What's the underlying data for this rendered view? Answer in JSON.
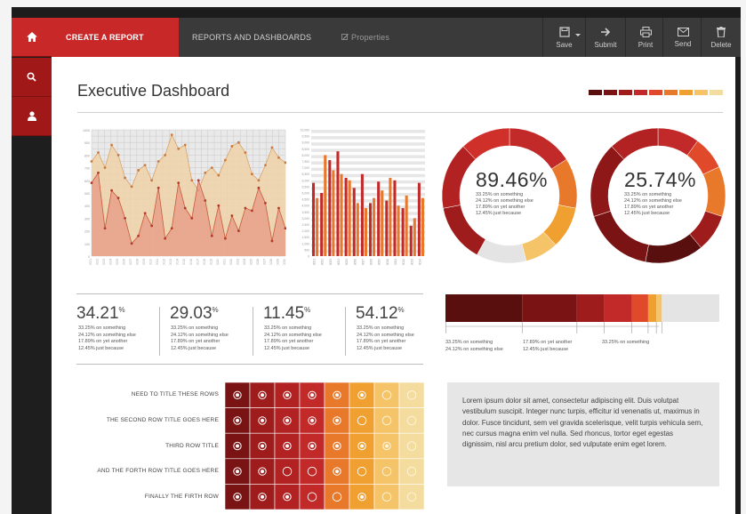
{
  "nav": {
    "create_label": "CREATE A REPORT",
    "reports_label": "REPORTS AND DASHBOARDS",
    "properties_label": "Properties",
    "tools": [
      {
        "label": "Save",
        "icon": "save-icon"
      },
      {
        "label": "Submit",
        "icon": "arrow-right-icon"
      },
      {
        "label": "Print",
        "icon": "printer-icon"
      },
      {
        "label": "Send",
        "icon": "envelope-icon"
      },
      {
        "label": "Delete",
        "icon": "trash-icon"
      }
    ],
    "sidebar": [
      "home-icon",
      "search-icon",
      "user-icon"
    ]
  },
  "page": {
    "title": "Executive Dashboard"
  },
  "palette": [
    "#5a0f0f",
    "#7a1414",
    "#9e1c1c",
    "#c22a2a",
    "#e0492a",
    "#e8782a",
    "#f0a030",
    "#f5c468",
    "#f3dc9e"
  ],
  "stats": [
    {
      "value": "34.21",
      "unit": "%",
      "lines": [
        "33.25% on something",
        "24.12% on something else",
        "17.89% on yet another",
        "12.45% just because"
      ]
    },
    {
      "value": "29.03",
      "unit": "%",
      "lines": [
        "33.25% on something",
        "24.12% on something else",
        "17.89% on yet another",
        "12.45% just because"
      ]
    },
    {
      "value": "11.45",
      "unit": "%",
      "lines": [
        "33.25% on something",
        "24.12% on something else",
        "17.89% on yet another",
        "12.45% just because"
      ]
    },
    {
      "value": "54.12",
      "unit": "%",
      "lines": [
        "33.25% on something",
        "24.12% on something else",
        "17.89% on yet another",
        "12.45% just because"
      ]
    }
  ],
  "donuts": [
    {
      "value": "89.46%",
      "lines": [
        "33.25% on something",
        "24.12% on something else",
        "17.89% on yet another",
        "12.45% just because"
      ],
      "segments": [
        {
          "v": 16,
          "c": "#c22a2a"
        },
        {
          "v": 12,
          "c": "#e8782a"
        },
        {
          "v": 10,
          "c": "#f0a030"
        },
        {
          "v": 8,
          "c": "#f5c468"
        },
        {
          "v": 12,
          "c": "#e4e4e4"
        },
        {
          "v": 14,
          "c": "#9e1c1c"
        },
        {
          "v": 16,
          "c": "#b22222"
        },
        {
          "v": 12,
          "c": "#d0302a"
        }
      ]
    },
    {
      "value": "25.74%",
      "lines": [
        "33.25% on something",
        "24.12% on something else",
        "17.89% on yet another",
        "12.45% just because"
      ],
      "segments": [
        {
          "v": 10,
          "c": "#c22a2a"
        },
        {
          "v": 8,
          "c": "#e0492a"
        },
        {
          "v": 12,
          "c": "#e8782a"
        },
        {
          "v": 9,
          "c": "#9e1c1c"
        },
        {
          "v": 14,
          "c": "#5a0f0f"
        },
        {
          "v": 17,
          "c": "#7a1414"
        },
        {
          "v": 18,
          "c": "#8e1818"
        },
        {
          "v": 12,
          "c": "#b22222"
        }
      ]
    }
  ],
  "stacked_bar": {
    "segments": [
      {
        "v": 28,
        "c": "#5a0f0f"
      },
      {
        "v": 20,
        "c": "#7a1414"
      },
      {
        "v": 10,
        "c": "#9e1c1c"
      },
      {
        "v": 10,
        "c": "#c22a2a"
      },
      {
        "v": 6,
        "c": "#e0492a"
      },
      {
        "v": 3,
        "c": "#f0a030"
      },
      {
        "v": 2,
        "c": "#f5c468"
      },
      {
        "v": 21,
        "c": "#e4e4e4"
      }
    ],
    "legend": [
      {
        "lines": [
          "33.25% on something",
          "24.12% on something else"
        ]
      },
      {
        "lines": [
          "17.89% on yet another",
          "12.45% just because"
        ]
      },
      {
        "lines": [
          "33.25% on something"
        ]
      }
    ]
  },
  "matrix": {
    "rows": [
      {
        "label": "NEED TO TITLE THESE ROWS",
        "cells": [
          "dot",
          "dot",
          "dot",
          "dot",
          "dot",
          "dot",
          "ring",
          "ring"
        ]
      },
      {
        "label": "THE SECOND ROW TITLE GOES HERE",
        "cells": [
          "dot",
          "dot",
          "dot",
          "dot",
          "dot",
          "ring",
          "ring",
          "ring"
        ]
      },
      {
        "label": "THIRD ROW TITLE",
        "cells": [
          "dot",
          "dot",
          "dot",
          "dot",
          "dot",
          "dot",
          "dot",
          "ring"
        ]
      },
      {
        "label": "AND THE FORTH ROW TITLE GOES HERE",
        "cells": [
          "dot",
          "dot",
          "ring",
          "ring",
          "dot",
          "ring",
          "ring",
          "ring"
        ]
      },
      {
        "label": "FINALLY THE FIRTH ROW",
        "cells": [
          "dot",
          "dot",
          "dot",
          "ring",
          "ring",
          "dot",
          "ring",
          "ring"
        ]
      }
    ],
    "col_colors": [
      "#7a1414",
      "#9e1c1c",
      "#b22222",
      "#c22a2a",
      "#e8782a",
      "#f0a030",
      "#f5c468",
      "#f3dc9e"
    ]
  },
  "lorem": "Lorem ipsum dolor sit amet, consectetur adipiscing elit. Duis volutpat vestibulum suscipit. Integer nunc turpis, efficitur id venenatis ut, maximus in dolor. Fusce tincidunt, sem vel gravida scelerisque, velit turpis vehicula sem, nec cursus magna enim vel nulla. Sed rhoncus, tortor eget egestas dignissim, nisl arcu pretium dolor, sed vulputate enim eget lorem.",
  "chart_data": [
    {
      "type": "area",
      "x": [
        1,
        2,
        3,
        4,
        5,
        6,
        7,
        8,
        9,
        10,
        11,
        12,
        13,
        14,
        15,
        16,
        17,
        18,
        19,
        20,
        21,
        22,
        23,
        24,
        25,
        26,
        27,
        28,
        29,
        30
      ],
      "series": [
        {
          "values": [
            7.5,
            8.2,
            7.0,
            8.8,
            8.0,
            6.2,
            5.5,
            6.8,
            7.2,
            6.0,
            7.5,
            8.0,
            9.6,
            8.5,
            8.8,
            6.0,
            5.2,
            6.6,
            7.0,
            6.4,
            7.6,
            8.7,
            9.0,
            8.2,
            6.5,
            6.0,
            7.2,
            8.6,
            7.8,
            7.4
          ],
          "color": "#f0d2a8"
        },
        {
          "values": [
            5.8,
            6.6,
            2.2,
            5.2,
            4.6,
            3.0,
            1.0,
            1.6,
            3.4,
            2.4,
            5.4,
            1.4,
            2.2,
            5.8,
            3.8,
            3.0,
            6.0,
            4.4,
            1.6,
            4.0,
            1.4,
            3.2,
            2.0,
            3.8,
            3.6,
            5.4,
            4.2,
            1.2,
            3.8,
            2.2
          ],
          "color": "#e8a08a"
        }
      ],
      "ylim": [
        0,
        10
      ]
    },
    {
      "type": "bar",
      "categories": [
        1,
        2,
        3,
        4,
        5,
        6,
        7,
        8,
        9,
        10,
        11,
        12,
        13,
        14
      ],
      "series": [
        {
          "values": [
            5.8,
            5.0,
            7.6,
            8.3,
            6.2,
            5.4,
            6.5,
            4.2,
            5.9,
            4.4,
            6.0,
            3.8,
            2.4,
            5.8
          ],
          "color": "#c22a2a"
        },
        {
          "values": [
            4.6,
            8.0,
            6.8,
            6.5,
            6.0,
            4.2,
            3.8,
            4.6,
            5.2,
            6.2,
            4.0,
            4.8,
            3.0,
            4.6
          ],
          "color": "#e8782a"
        }
      ],
      "ylim": [
        0,
        10
      ]
    }
  ]
}
